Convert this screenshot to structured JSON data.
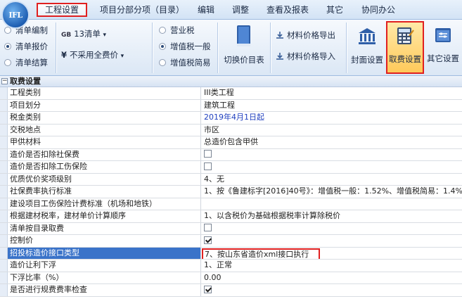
{
  "logo_text": "IFL",
  "menu": {
    "items": [
      {
        "label": "工程设置",
        "active": true
      },
      {
        "label": "项目分部分项（目录）"
      },
      {
        "label": "编辑"
      },
      {
        "label": "调整"
      },
      {
        "label": "查看及报表"
      },
      {
        "label": "其它"
      },
      {
        "label": "协同办公"
      }
    ]
  },
  "ribbon": {
    "mode_options": [
      {
        "label": "清单编制",
        "selected": false
      },
      {
        "label": "清单报价",
        "selected": true
      },
      {
        "label": "清单结算",
        "selected": false
      }
    ],
    "standard": {
      "prefix": "GB",
      "label": "13清单",
      "arrow": "▾"
    },
    "fee_option": {
      "prefix": "¥",
      "label": "不采用全费价",
      "arrow": "▾"
    },
    "tax_options": [
      {
        "label": "营业税",
        "selected": false
      },
      {
        "label": "增值税一般",
        "selected": true
      },
      {
        "label": "增值税简易",
        "selected": false
      }
    ],
    "switch_price_catalog": "切换价目表",
    "export_material_price": "材料价格导出",
    "import_material_price": "材料价格导入",
    "cover_settings": "封面设置",
    "fee_settings": "取费设置",
    "other_settings": "其它设置"
  },
  "section_title": "取费设置",
  "rows": [
    {
      "key": "工程类别",
      "value": "III类工程"
    },
    {
      "key": "项目划分",
      "value": "建筑工程"
    },
    {
      "key": "税金类别",
      "value": "2019年4月1日起",
      "blue": true
    },
    {
      "key": "交税地点",
      "value": "市区"
    },
    {
      "key": "甲供材料",
      "value": "总造价包含甲供"
    },
    {
      "key": "造价是否扣除社保费",
      "checkbox": false
    },
    {
      "key": "造价是否扣除工伤保险",
      "checkbox": false
    },
    {
      "key": "优质优价奖项级别",
      "value": "4、无"
    },
    {
      "key": "社保费率执行标准",
      "value": "1、按《鲁建标字[2016]40号》：增值税一般：1.52%、增值税简易：1.4%"
    },
    {
      "key": "建设项目工伤保险计费标准（机场和地铁）",
      "value": ""
    },
    {
      "key": "根据建材税率，建材单价计算顺序",
      "value": "1、以含税价为基础根据税率计算除税价"
    },
    {
      "key": "清单按目录取费",
      "checkbox": false
    },
    {
      "key": "控制价",
      "checkbox": true
    },
    {
      "key": "招投标造价接口类型",
      "value": "7、按山东省造价xml接口执行",
      "highlighted": true
    },
    {
      "key": "造价让利下浮",
      "value": "1、正常"
    },
    {
      "key": "下浮比率（%）",
      "value": "0.00"
    },
    {
      "key": "是否进行规费费率检查",
      "checkbox": true
    }
  ]
}
